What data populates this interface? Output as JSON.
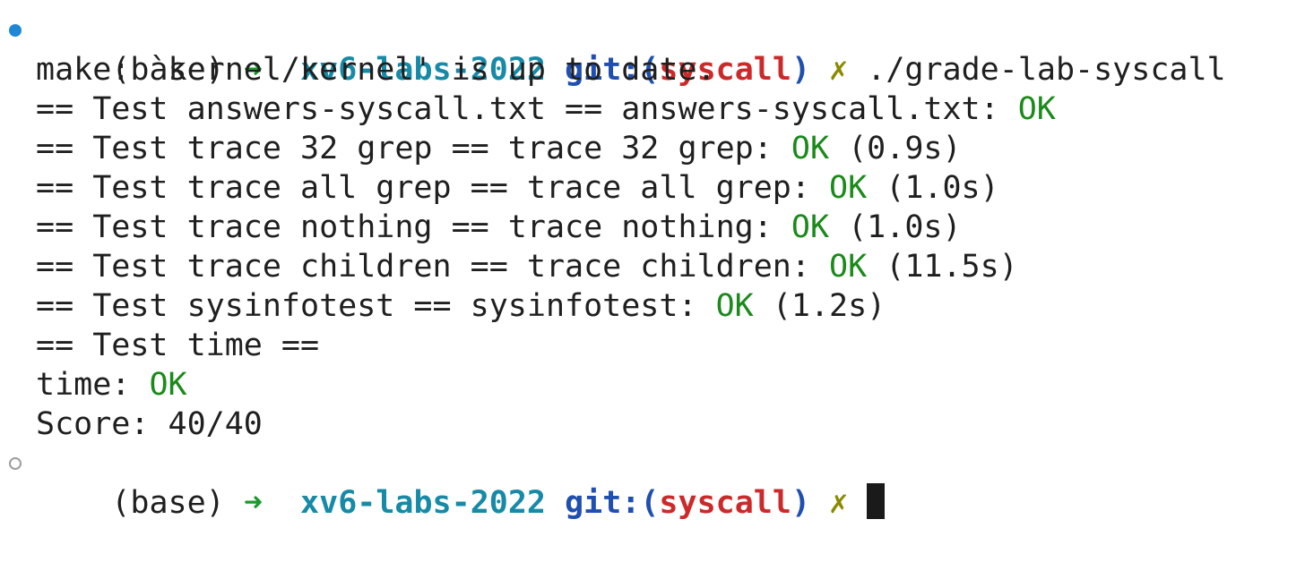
{
  "prompt": {
    "env": "(base)",
    "arrow": "➜",
    "dir": "xv6-labs-2022",
    "git_prefix": "git:(",
    "branch": "syscall",
    "git_suffix": ")",
    "dirty_mark": "✗"
  },
  "command": "./grade-lab-syscall",
  "output": {
    "make_line": "make: `kernel/kernel' is up to date.",
    "tests": [
      {
        "label": "== Test answers-syscall.txt == answers-syscall.txt: ",
        "status": "OK",
        "time": ""
      },
      {
        "label": "== Test trace 32 grep == trace 32 grep: ",
        "status": "OK",
        "time": " (0.9s)"
      },
      {
        "label": "== Test trace all grep == trace all grep: ",
        "status": "OK",
        "time": " (1.0s)"
      },
      {
        "label": "== Test trace nothing == trace nothing: ",
        "status": "OK",
        "time": " (1.0s)"
      },
      {
        "label": "== Test trace children == trace children: ",
        "status": "OK",
        "time": " (11.5s)"
      },
      {
        "label": "== Test sysinfotest == sysinfotest: ",
        "status": "OK",
        "time": " (1.2s)"
      }
    ],
    "time_header": "== Test time ==",
    "time_result": {
      "label": "time: ",
      "status": "OK"
    },
    "score": "Score: 40/40"
  },
  "colors": {
    "marker_active": "#1e88d6",
    "marker_inactive": "#9e9e9e",
    "ok": "#1a8a1a",
    "branch": "#cc2a2a",
    "dir": "#168aa6",
    "git": "#1f4fb0",
    "arrow": "#1a9a2a"
  }
}
